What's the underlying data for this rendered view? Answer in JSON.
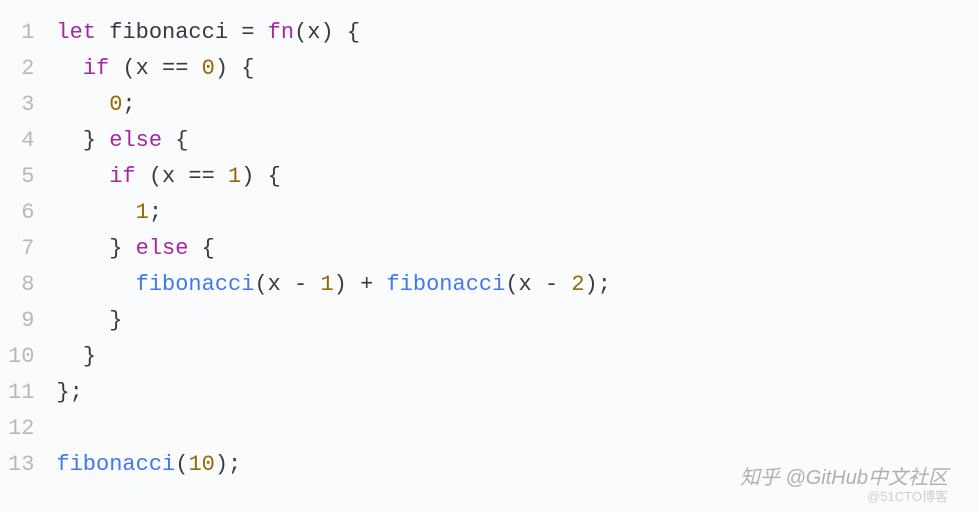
{
  "lineCount": 13,
  "code": {
    "lines": [
      {
        "n": 1,
        "indent": 0,
        "tokens": [
          {
            "t": "let ",
            "c": "kw"
          },
          {
            "t": "fibonacci",
            "c": "id"
          },
          {
            "t": " = ",
            "c": "op"
          },
          {
            "t": "fn",
            "c": "kw"
          },
          {
            "t": "(",
            "c": "paren"
          },
          {
            "t": "x",
            "c": "id"
          },
          {
            "t": ")",
            "c": "paren"
          },
          {
            "t": " {",
            "c": "brace"
          }
        ]
      },
      {
        "n": 2,
        "indent": 1,
        "tokens": [
          {
            "t": "if ",
            "c": "kw"
          },
          {
            "t": "(",
            "c": "paren"
          },
          {
            "t": "x",
            "c": "id"
          },
          {
            "t": " == ",
            "c": "op"
          },
          {
            "t": "0",
            "c": "num"
          },
          {
            "t": ")",
            "c": "paren"
          },
          {
            "t": " {",
            "c": "brace"
          }
        ]
      },
      {
        "n": 3,
        "indent": 2,
        "tokens": [
          {
            "t": "0",
            "c": "num"
          },
          {
            "t": ";",
            "c": "semi"
          }
        ]
      },
      {
        "n": 4,
        "indent": 1,
        "tokens": [
          {
            "t": "} ",
            "c": "brace"
          },
          {
            "t": "else",
            "c": "kw"
          },
          {
            "t": " {",
            "c": "brace"
          }
        ]
      },
      {
        "n": 5,
        "indent": 2,
        "tokens": [
          {
            "t": "if ",
            "c": "kw"
          },
          {
            "t": "(",
            "c": "paren"
          },
          {
            "t": "x",
            "c": "id"
          },
          {
            "t": " == ",
            "c": "op"
          },
          {
            "t": "1",
            "c": "num"
          },
          {
            "t": ")",
            "c": "paren"
          },
          {
            "t": " {",
            "c": "brace"
          }
        ]
      },
      {
        "n": 6,
        "indent": 3,
        "tokens": [
          {
            "t": "1",
            "c": "num"
          },
          {
            "t": ";",
            "c": "semi"
          }
        ]
      },
      {
        "n": 7,
        "indent": 2,
        "tokens": [
          {
            "t": "} ",
            "c": "brace"
          },
          {
            "t": "else",
            "c": "kw"
          },
          {
            "t": " {",
            "c": "brace"
          }
        ]
      },
      {
        "n": 8,
        "indent": 3,
        "tokens": [
          {
            "t": "fibonacci",
            "c": "fn"
          },
          {
            "t": "(",
            "c": "paren"
          },
          {
            "t": "x",
            "c": "id"
          },
          {
            "t": " - ",
            "c": "op"
          },
          {
            "t": "1",
            "c": "num"
          },
          {
            "t": ")",
            "c": "paren"
          },
          {
            "t": " + ",
            "c": "op"
          },
          {
            "t": "fibonacci",
            "c": "fn"
          },
          {
            "t": "(",
            "c": "paren"
          },
          {
            "t": "x",
            "c": "id"
          },
          {
            "t": " - ",
            "c": "op"
          },
          {
            "t": "2",
            "c": "num"
          },
          {
            "t": ")",
            "c": "paren"
          },
          {
            "t": ";",
            "c": "semi"
          }
        ]
      },
      {
        "n": 9,
        "indent": 2,
        "tokens": [
          {
            "t": "}",
            "c": "brace"
          }
        ]
      },
      {
        "n": 10,
        "indent": 1,
        "tokens": [
          {
            "t": "}",
            "c": "brace"
          }
        ]
      },
      {
        "n": 11,
        "indent": 0,
        "tokens": [
          {
            "t": "};",
            "c": "brace"
          }
        ]
      },
      {
        "n": 12,
        "indent": 0,
        "tokens": []
      },
      {
        "n": 13,
        "indent": 0,
        "tokens": [
          {
            "t": "fibonacci",
            "c": "fn"
          },
          {
            "t": "(",
            "c": "paren"
          },
          {
            "t": "10",
            "c": "num"
          },
          {
            "t": ")",
            "c": "paren"
          },
          {
            "t": ";",
            "c": "semi"
          }
        ]
      }
    ]
  },
  "watermarks": {
    "primary": "知乎 @GitHub中文社区",
    "secondary": "@51CTO博客"
  }
}
